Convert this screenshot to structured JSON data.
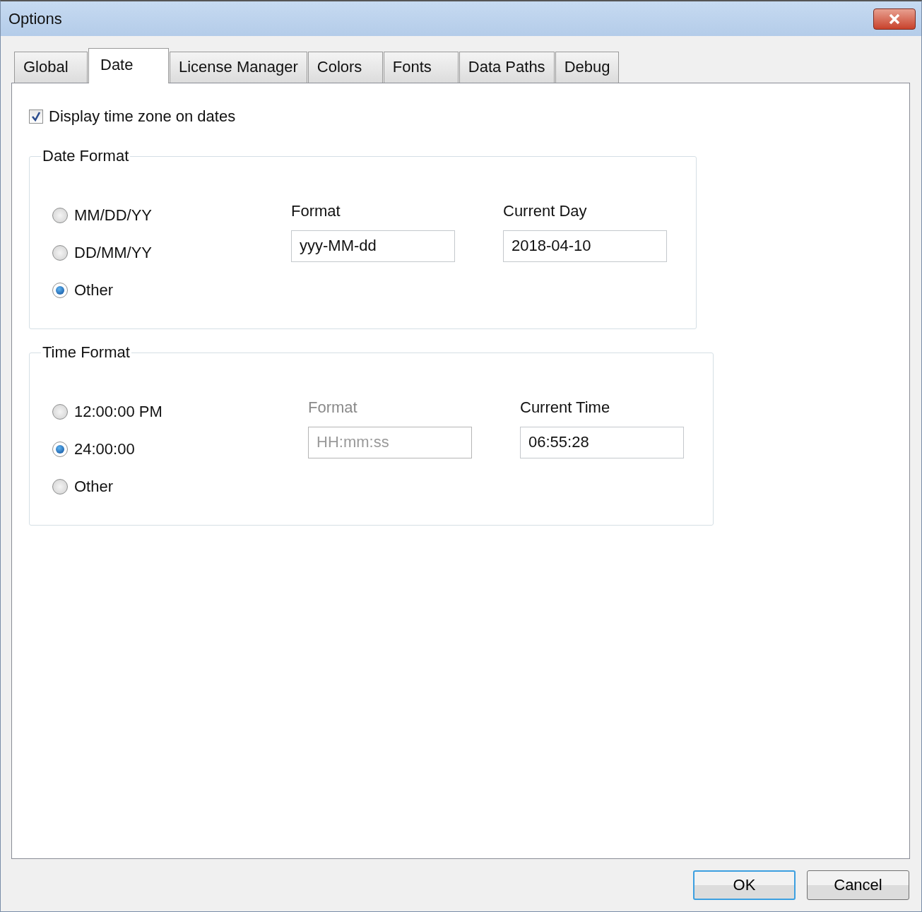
{
  "window": {
    "title": "Options"
  },
  "tabs": [
    {
      "label": "Global",
      "selected": false
    },
    {
      "label": "Date",
      "selected": true
    },
    {
      "label": "License Manager",
      "selected": false
    },
    {
      "label": "Colors",
      "selected": false
    },
    {
      "label": "Fonts",
      "selected": false
    },
    {
      "label": "Data Paths",
      "selected": false
    },
    {
      "label": "Debug",
      "selected": false
    }
  ],
  "display_time_zone": {
    "label": "Display time zone on dates",
    "checked": true
  },
  "groups": [
    {
      "title": "Date Format",
      "options": [
        {
          "label": "MM/DD/YY",
          "selected": false
        },
        {
          "label": "DD/MM/YY",
          "selected": false
        },
        {
          "label": "Other",
          "selected": true
        }
      ],
      "format": {
        "label": "Format",
        "value": "yyy-MM-dd",
        "disabled": false
      },
      "current": {
        "label": "Current Day",
        "value": "2018-04-10"
      }
    },
    {
      "title": "Time Format",
      "options": [
        {
          "label": "12:00:00 PM",
          "selected": false
        },
        {
          "label": "24:00:00",
          "selected": true
        },
        {
          "label": "Other",
          "selected": false
        }
      ],
      "format": {
        "label": "Format",
        "value": "HH:mm:ss",
        "disabled": true
      },
      "current": {
        "label": "Current Time",
        "value": "06:55:28"
      }
    }
  ],
  "buttons": [
    {
      "label": "OK",
      "default": true
    },
    {
      "label": "Cancel",
      "default": false
    }
  ]
}
